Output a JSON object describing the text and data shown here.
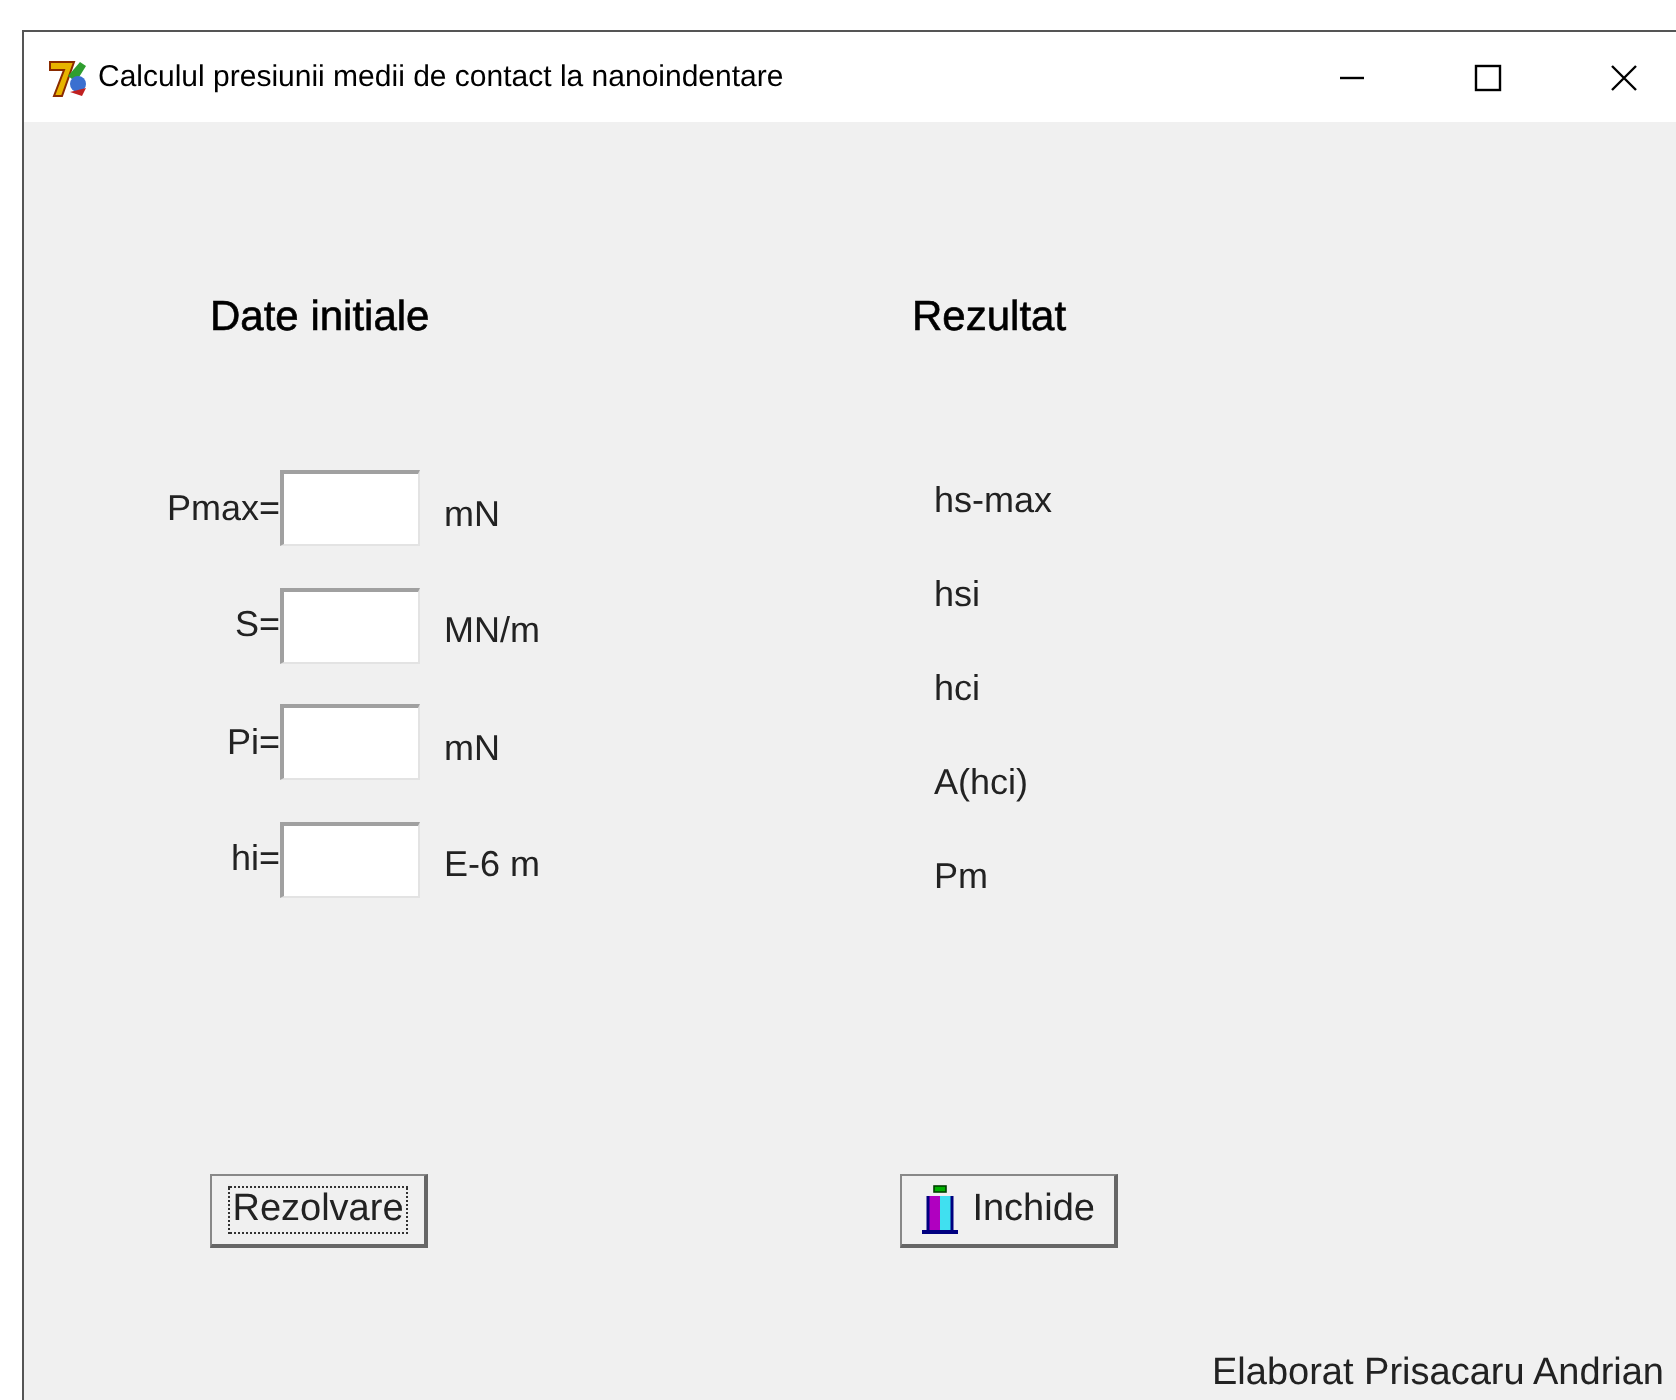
{
  "window": {
    "title": "Calculul presiunii medii de contact la nanoindentare"
  },
  "inputs": {
    "heading": "Date initiale",
    "fields": [
      {
        "label": "Pmax=",
        "unit": "mN"
      },
      {
        "label": "S=",
        "unit": "MN/m"
      },
      {
        "label": "Pi=",
        "unit": "mN"
      },
      {
        "label": "hi=",
        "unit": "E-6 m"
      }
    ]
  },
  "results": {
    "heading": "Rezultat",
    "labels": [
      "hs-max",
      "hsi",
      "hci",
      "A(hci)",
      "Pm"
    ]
  },
  "buttons": [
    {
      "label": "Rezolvare",
      "kind": "text",
      "focused": true
    },
    {
      "label": "Inchide",
      "kind": "icon",
      "focused": false
    }
  ],
  "footer": "Elaborat Prisacaru Andrian"
}
